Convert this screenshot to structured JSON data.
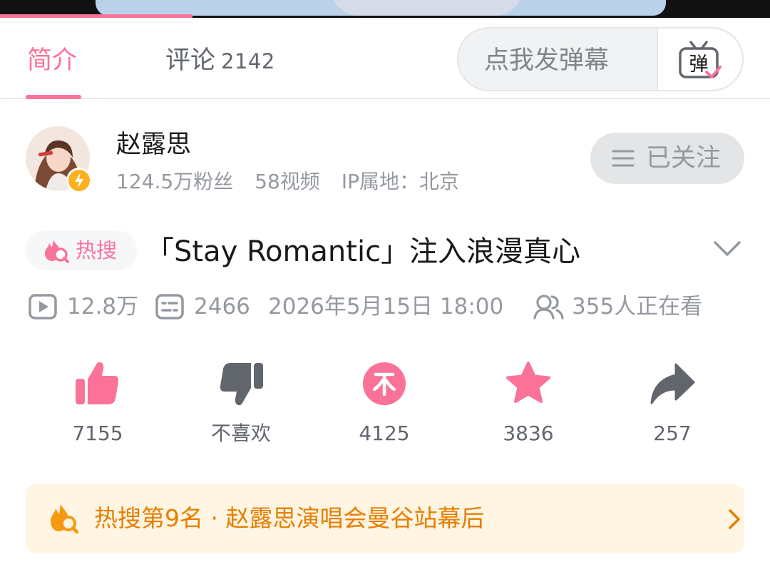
{
  "player": {
    "progress_fraction": 0.25
  },
  "tabs": {
    "intro_label": "简介",
    "comments_label": "评论",
    "comments_count": "2142"
  },
  "danmaku": {
    "placeholder": "点我发弹幕",
    "button_glyph": "弹"
  },
  "uploader": {
    "name": "赵露思",
    "followers": "124.5万粉丝",
    "videos": "58视频",
    "ip_location": "IP属地：北京",
    "follow_label": "已关注"
  },
  "video": {
    "hot_tag": "热搜",
    "title": "「Stay Romantic」注入浪漫真心",
    "views": "12.8万",
    "danmaku_count": "2466",
    "publish_time": "2026年5月15日 18:00",
    "watching_now": "355人正在看"
  },
  "actions": {
    "like_count": "7155",
    "dislike_label": "不喜欢",
    "coin_count": "4125",
    "favorite_count": "3836",
    "share_count": "257"
  },
  "hot_banner": {
    "text": "热搜第9名 · 赵露思演唱会曼谷站幕后"
  },
  "colors": {
    "accent_pink": "#fb7299",
    "dislike_gray": "#61666d",
    "hot_orange": "#e67e00",
    "hot_banner_bg": "#fff5e2"
  },
  "icons": [
    "tv-danmaku-icon",
    "verified-badge-icon",
    "menu-lines-icon",
    "hot-search-flame-icon",
    "chevron-down-icon",
    "play-icon",
    "danmaku-icon",
    "viewers-icon",
    "thumb-up-icon",
    "thumb-down-icon",
    "coin-icon",
    "star-icon",
    "share-icon",
    "chevron-right-icon"
  ]
}
